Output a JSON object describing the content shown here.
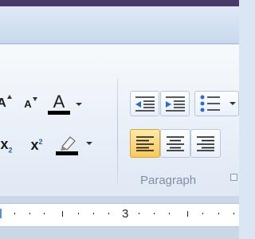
{
  "window": {
    "title_bar_color": "#4a3a6a"
  },
  "font_group": {
    "grow_font": {
      "icon": "grow-font-icon",
      "letter": "A"
    },
    "shrink_font": {
      "icon": "shrink-font-icon",
      "letter": "A"
    },
    "font_color": {
      "icon": "font-color-icon",
      "letter": "A",
      "color": "#000000"
    },
    "subscript": {
      "icon": "subscript-icon",
      "letter": "x",
      "sub": "2"
    },
    "superscript": {
      "icon": "superscript-icon",
      "letter": "x",
      "sup": "2"
    },
    "highlight": {
      "icon": "text-highlight-color-icon",
      "color": "#000000"
    }
  },
  "paragraph_group": {
    "label": "Paragraph",
    "decrease_indent": {
      "icon": "decrease-indent-icon"
    },
    "increase_indent": {
      "icon": "increase-indent-icon"
    },
    "bullets": {
      "icon": "bullets-icon"
    },
    "align_left": {
      "icon": "align-left-icon",
      "active": true
    },
    "center": {
      "icon": "align-center-icon"
    },
    "align_right": {
      "icon": "align-right-icon"
    },
    "dialog_launcher": {
      "icon": "dialog-launcher-icon"
    }
  },
  "ruler": {
    "visible_number": "3"
  },
  "colors": {
    "accent_active": "#f8c95e",
    "group_label": "#7f8fa6",
    "ribbon_bg": "#eaf0f8"
  }
}
